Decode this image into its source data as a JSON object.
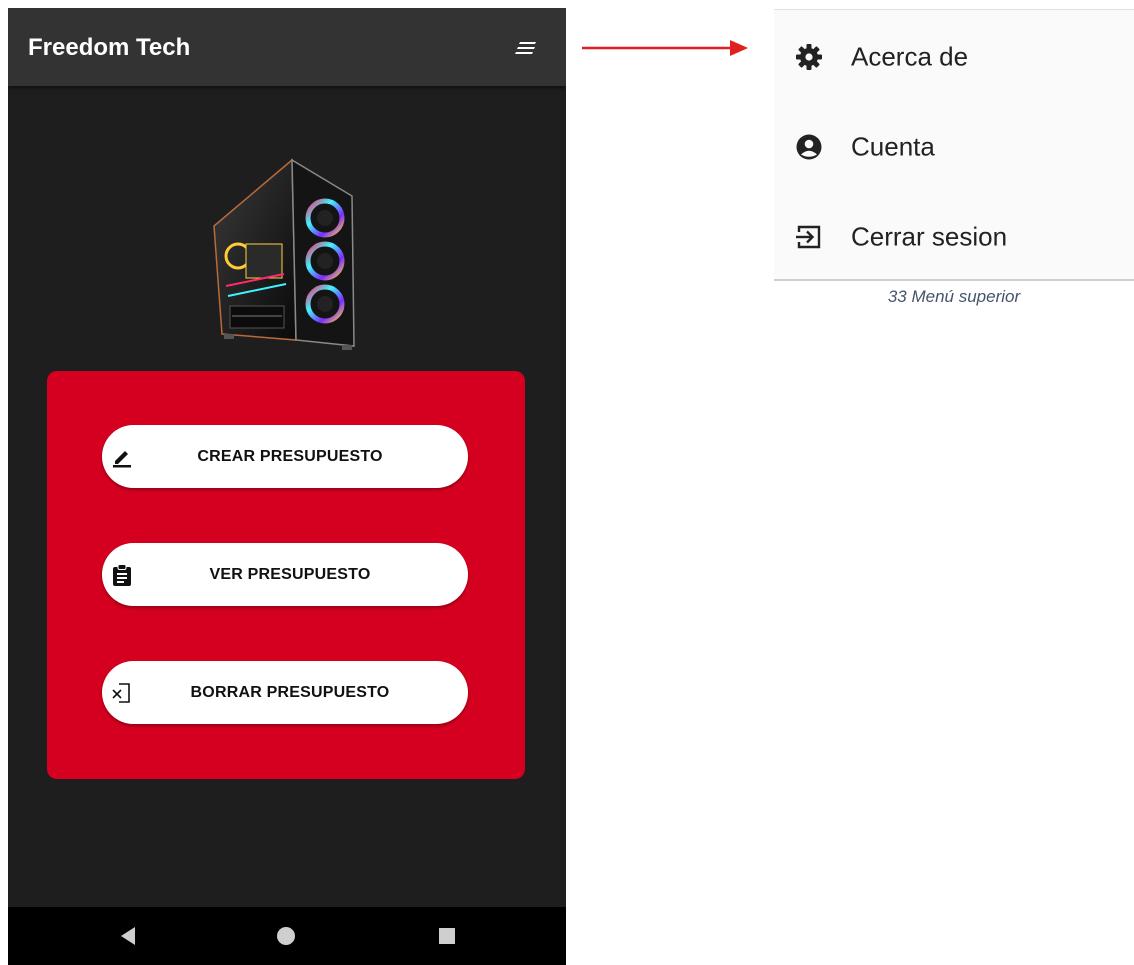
{
  "app": {
    "title": "Freedom Tech"
  },
  "hero": {
    "icon": "pc-tower-image"
  },
  "actions": [
    {
      "label": "CREAR PRESUPUESTO",
      "icon": "edit-pencil-icon"
    },
    {
      "label": "VER PRESUPUESTO",
      "icon": "clipboard-icon"
    },
    {
      "label": "BORRAR PRESUPUESTO",
      "icon": "delete-document-icon"
    }
  ],
  "overflow_menu": {
    "items": [
      {
        "label": "Acerca de",
        "icon": "gear-icon"
      },
      {
        "label": "Cuenta",
        "icon": "account-circle-icon"
      },
      {
        "label": "Cerrar sesion",
        "icon": "logout-icon"
      }
    ]
  },
  "caption": "33 Menú superior",
  "colors": {
    "appbar": "#333333",
    "background": "#1e1e1e",
    "panel": "#d50020",
    "button": "#ffffff",
    "arrow": "#e02020",
    "navbar": "#000000"
  }
}
